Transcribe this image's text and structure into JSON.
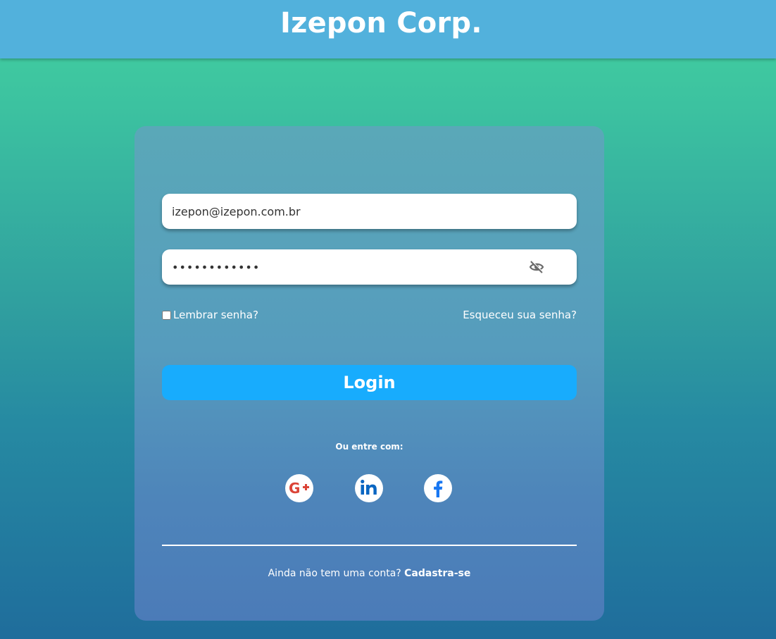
{
  "header": {
    "brand": "Izepon Corp."
  },
  "login_form": {
    "email_value": "izepon@izepon.com.br",
    "password_value": "••••••••••••",
    "show_password_icon": "eye-off-icon",
    "remember_label": "Lembrar senha?",
    "forgot_label": "Esqueceu sua senha?",
    "login_label": "Login"
  },
  "social": {
    "heading": "Ou entre com:",
    "providers": [
      {
        "name": "google-plus",
        "icon": "google-plus-icon",
        "color": "#db4437"
      },
      {
        "name": "linkedin",
        "icon": "linkedin-icon",
        "color": "#0a66c2"
      },
      {
        "name": "facebook",
        "icon": "facebook-icon",
        "color": "#1877f2"
      }
    ]
  },
  "signup": {
    "prompt": "Ainda não tem uma conta?",
    "link": "Cadastra-se"
  },
  "colors": {
    "header_bg": "#52b1dc",
    "login_button": "#18acfd",
    "page_gradient_top": "#44d19f",
    "page_gradient_bottom": "#1f6d9c"
  }
}
